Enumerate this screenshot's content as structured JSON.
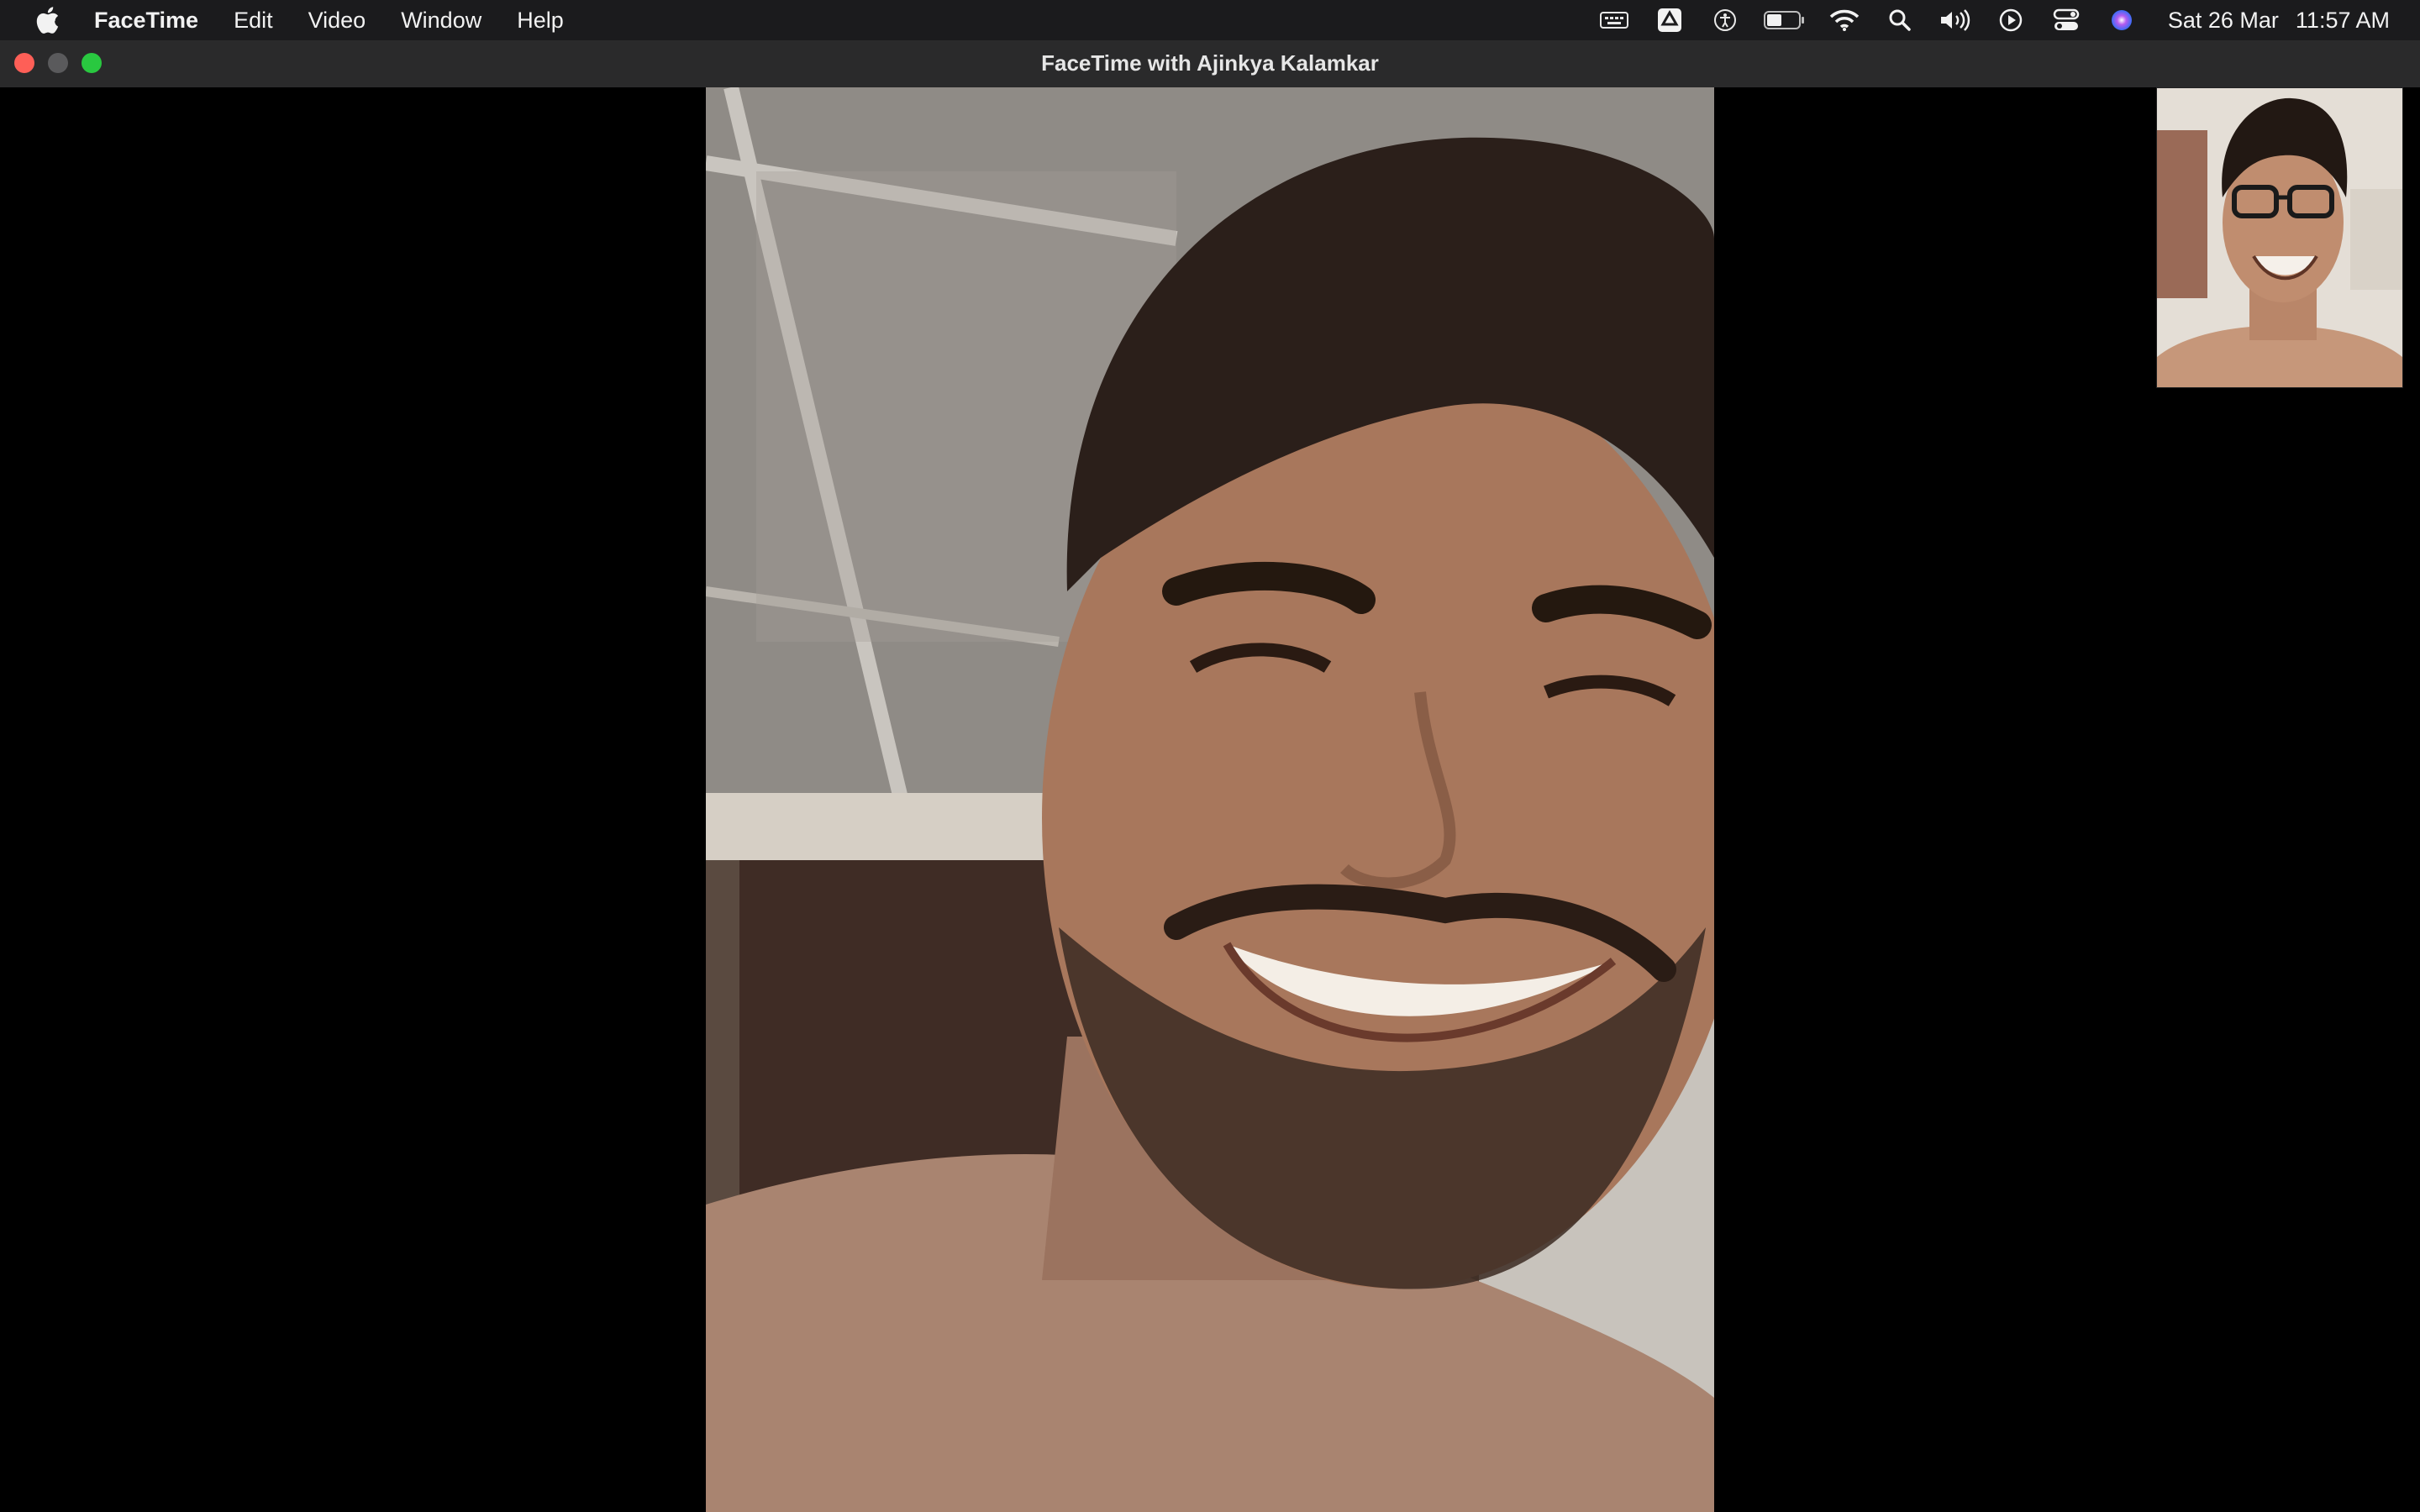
{
  "menu_bar": {
    "app_name": "FaceTime",
    "menus": [
      "Edit",
      "Video",
      "Window",
      "Help"
    ],
    "status_icons": [
      "keyboard-brightness-icon",
      "google-drive-icon",
      "accessibility-icon",
      "battery-icon",
      "wifi-icon",
      "spotlight-search-icon",
      "volume-icon",
      "now-playing-icon",
      "control-center-icon",
      "siri-icon"
    ],
    "date": "Sat 26 Mar",
    "time": "11:57 AM"
  },
  "window": {
    "title": "FaceTime with Ajinkya Kalamkar"
  },
  "colors": {
    "close": "#fe5f57",
    "minimize": "#5a5a5c",
    "zoom": "#29c840",
    "background": "#000000"
  }
}
